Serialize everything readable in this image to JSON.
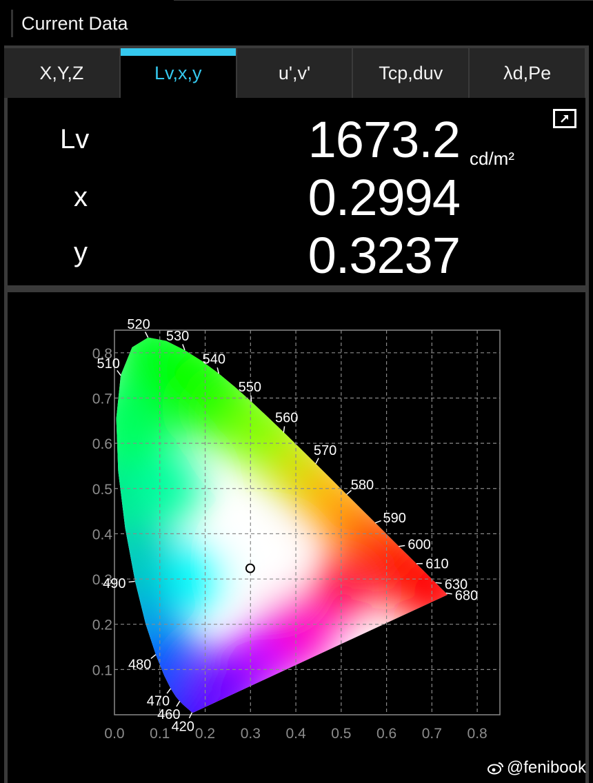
{
  "window": {
    "title": "Current Data"
  },
  "tabs": [
    {
      "label": "X,Y,Z",
      "active": false
    },
    {
      "label": "Lv,x,y",
      "active": true
    },
    {
      "label": "u',v'",
      "active": false
    },
    {
      "label": "Tcp,duv",
      "active": false
    },
    {
      "label": "λd,Pe",
      "active": false
    }
  ],
  "measurements": {
    "lv": {
      "label": "Lv",
      "value": "1673.2",
      "unit": "cd/m²"
    },
    "x": {
      "label": "x",
      "value": "0.2994"
    },
    "y": {
      "label": "y",
      "value": "0.3237"
    }
  },
  "accent_color": "#35c8ee",
  "chart_data": {
    "type": "scatter",
    "title": "",
    "xlabel": "",
    "ylabel": "",
    "xlim": [
      0.0,
      0.85
    ],
    "ylim": [
      0.0,
      0.85
    ],
    "grid": true,
    "x_ticks": [
      "0.0",
      "0.1",
      "0.2",
      "0.3",
      "0.4",
      "0.5",
      "0.6",
      "0.7",
      "0.8"
    ],
    "y_ticks": [
      "0.1",
      "0.2",
      "0.3",
      "0.4",
      "0.5",
      "0.6",
      "0.7",
      "0.8"
    ],
    "y_tick_values": [
      0.1,
      0.2,
      0.3,
      0.4,
      0.5,
      0.6,
      0.7,
      0.8
    ],
    "x_tick_values": [
      0.0,
      0.1,
      0.2,
      0.3,
      0.4,
      0.5,
      0.6,
      0.7,
      0.8
    ],
    "spectral_locus_labels": [
      {
        "nm": "420",
        "x": 0.171,
        "y": 0.005
      },
      {
        "nm": "460",
        "x": 0.144,
        "y": 0.03
      },
      {
        "nm": "470",
        "x": 0.124,
        "y": 0.058
      },
      {
        "nm": "480",
        "x": 0.091,
        "y": 0.133
      },
      {
        "nm": "490",
        "x": 0.045,
        "y": 0.295
      },
      {
        "nm": "510",
        "x": 0.014,
        "y": 0.75
      },
      {
        "nm": "520",
        "x": 0.074,
        "y": 0.834
      },
      {
        "nm": "530",
        "x": 0.155,
        "y": 0.806
      },
      {
        "nm": "540",
        "x": 0.23,
        "y": 0.754
      },
      {
        "nm": "550",
        "x": 0.302,
        "y": 0.692
      },
      {
        "nm": "560",
        "x": 0.373,
        "y": 0.624
      },
      {
        "nm": "570",
        "x": 0.444,
        "y": 0.555
      },
      {
        "nm": "580",
        "x": 0.512,
        "y": 0.487
      },
      {
        "nm": "590",
        "x": 0.575,
        "y": 0.424
      },
      {
        "nm": "600",
        "x": 0.627,
        "y": 0.372
      },
      {
        "nm": "610",
        "x": 0.666,
        "y": 0.334
      },
      {
        "nm": "630",
        "x": 0.708,
        "y": 0.292
      },
      {
        "nm": "680",
        "x": 0.731,
        "y": 0.269
      }
    ],
    "series": [
      {
        "values": [
          {
            "x": 0.2994,
            "y": 0.3237
          }
        ]
      }
    ]
  },
  "watermark": "@fenibook"
}
